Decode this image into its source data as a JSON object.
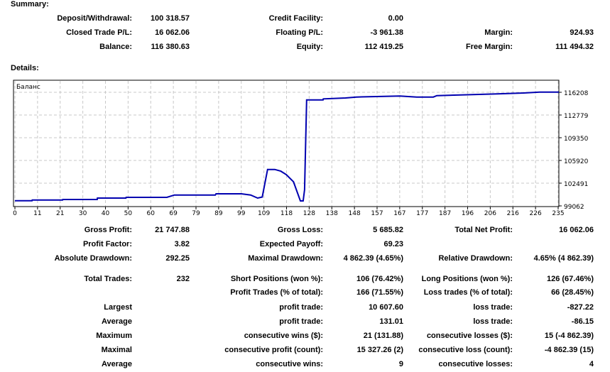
{
  "summary": {
    "title": "Summary:",
    "rows": [
      [
        "Deposit/Withdrawal:",
        "100 318.57",
        "Credit Facility:",
        "0.00",
        "",
        ""
      ],
      [
        "Closed Trade P/L:",
        "16 062.06",
        "Floating P/L:",
        "-3 961.38",
        "Margin:",
        "924.93"
      ],
      [
        "Balance:",
        "116 380.63",
        "Equity:",
        "112 419.25",
        "Free Margin:",
        "111 494.32"
      ]
    ]
  },
  "details": {
    "title": "Details:",
    "rows": [
      [
        "Gross Profit:",
        "21 747.88",
        "Gross Loss:",
        "5 685.82",
        "Total Net Profit:",
        "16 062.06"
      ],
      [
        "Profit Factor:",
        "3.82",
        "Expected Payoff:",
        "69.23",
        "",
        ""
      ],
      [
        "Absolute Drawdown:",
        "292.25",
        "Maximal Drawdown:",
        "4 862.39 (4.65%)",
        "Relative Drawdown:",
        "4.65% (4 862.39)"
      ],
      [
        "Total Trades:",
        "232",
        "Short Positions (won %):",
        "106 (76.42%)",
        "Long Positions (won %):",
        "126 (67.46%)"
      ],
      [
        "",
        "",
        "Profit Trades (% of total):",
        "166 (71.55%)",
        "Loss trades (% of total):",
        "66 (28.45%)"
      ],
      [
        "Largest",
        "",
        "profit trade:",
        "10 607.60",
        "loss trade:",
        "-827.22"
      ],
      [
        "Average",
        "",
        "profit trade:",
        "131.01",
        "loss trade:",
        "-86.15"
      ],
      [
        "Maximum",
        "",
        "consecutive wins ($):",
        "21 (131.88)",
        "consecutive losses ($):",
        "15 (-4 862.39)"
      ],
      [
        "Maximal",
        "",
        "consecutive profit (count):",
        "15 327.26 (2)",
        "consecutive loss (count):",
        "-4 862.39 (15)"
      ],
      [
        "Average",
        "",
        "consecutive wins:",
        "9",
        "consecutive losses:",
        "4"
      ]
    ]
  },
  "chart_data": {
    "type": "line",
    "title": "Баланс",
    "series": [
      {
        "name": "Баланс",
        "color": "#0000b0",
        "x": [
          0,
          7.4,
          7.5,
          20.6,
          20.7,
          35.6,
          35.7,
          48,
          48.1,
          65.7,
          69,
          86.7,
          87,
          98,
          102,
          105,
          107,
          109.3,
          112.4,
          115,
          117.4,
          120.5,
          123.5,
          124.7,
          125.3,
          126.2,
          133.3,
          133.4,
          143,
          147.7,
          166.5,
          173.8,
          181,
          182.5,
          194,
          208.6,
          220,
          227,
          236
        ],
        "y": [
          99845,
          99845,
          99940,
          99940,
          100025,
          100025,
          100240,
          100240,
          100350,
          100350,
          100700,
          100700,
          100880,
          100880,
          100700,
          100240,
          100400,
          104560,
          104560,
          104300,
          103780,
          102700,
          99810,
          99810,
          101500,
          115060,
          115060,
          115210,
          115350,
          115490,
          115640,
          115490,
          115490,
          115700,
          115820,
          115970,
          116100,
          116240,
          116240
        ]
      }
    ],
    "xticks": [
      "0",
      "11",
      "21",
      "30",
      "40",
      "50",
      "60",
      "69",
      "79",
      "89",
      "99",
      "109",
      "118",
      "128",
      "138",
      "148",
      "157",
      "167",
      "177",
      "187",
      "196",
      "206",
      "216",
      "226",
      "235"
    ],
    "yticks": [
      "99062",
      "102491",
      "105920",
      "109350",
      "112779",
      "116208"
    ],
    "xlim": [
      0,
      236
    ],
    "ylim": [
      99062,
      116208
    ],
    "grid": true
  }
}
